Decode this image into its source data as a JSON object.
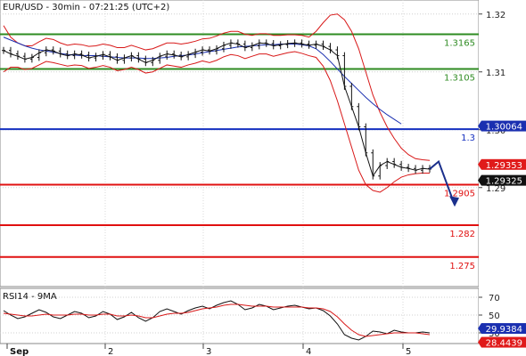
{
  "header": {
    "title": "EUR/USD - 30min - 07:21:25 (UTC+2)"
  },
  "chart_data": [
    {
      "type": "line",
      "panel": "price",
      "title": "EUR/USD - 30min - 07:21:25 (UTC+2)",
      "ylim": [
        1.2735,
        1.3215
      ],
      "y_ticks": [
        1.29,
        1.3,
        1.31,
        1.32
      ],
      "y_tick_labels": [
        "1.29",
        "1.30",
        "1.31",
        "1.32"
      ],
      "x_date_labels": [
        "Sep",
        "2",
        "3",
        "4",
        "5"
      ],
      "levels": [
        {
          "value": 1.3165,
          "label": "1.3165",
          "color": "#2e8b22"
        },
        {
          "value": 1.3105,
          "label": "1.3105",
          "color": "#2e8b22"
        },
        {
          "value": 1.3001,
          "label": "1.3",
          "color": "#1530c0"
        },
        {
          "value": 1.2905,
          "label": "1.2905",
          "color": "#e01010"
        },
        {
          "value": 1.2835,
          "label": "1.282",
          "color": "#e01010"
        },
        {
          "value": 1.278,
          "label": "1.275",
          "color": "#e01010"
        }
      ],
      "badges": [
        {
          "value": 1.30064,
          "label": "1.30064",
          "color": "#1a2fb0"
        },
        {
          "value": 1.29353,
          "label": "1.29353",
          "color": "#e01a1a"
        },
        {
          "value": 1.29325,
          "label": "1.29325",
          "color": "#111111"
        }
      ],
      "price_series": [
        1.3137,
        1.3131,
        1.3127,
        1.3122,
        1.3125,
        1.3133,
        1.3138,
        1.3136,
        1.3131,
        1.3128,
        1.3131,
        1.3129,
        1.3124,
        1.3127,
        1.313,
        1.3126,
        1.312,
        1.3124,
        1.3128,
        1.3122,
        1.3116,
        1.312,
        1.3127,
        1.3131,
        1.3129,
        1.3126,
        1.313,
        1.3134,
        1.3138,
        1.3136,
        1.314,
        1.3146,
        1.315,
        1.3148,
        1.3142,
        1.3145,
        1.315,
        1.3149,
        1.3145,
        1.3147,
        1.3149,
        1.315,
        1.3148,
        1.3146,
        1.3148,
        1.3144,
        1.3138,
        1.3128,
        1.3075,
        1.304,
        1.3005,
        1.296,
        1.292,
        1.2938,
        1.2945,
        1.294,
        1.2935,
        1.2933,
        1.293,
        1.2933,
        1.2932
      ],
      "ma_series": [
        1.316,
        1.3155,
        1.315,
        1.3145,
        1.3141,
        1.3138,
        1.3136,
        1.3134,
        1.3132,
        1.313,
        1.3129,
        1.3128,
        1.3128,
        1.3128,
        1.3127,
        1.3126,
        1.3125,
        1.3124,
        1.3124,
        1.3124,
        1.3123,
        1.3123,
        1.3124,
        1.3125,
        1.3127,
        1.3128,
        1.3129,
        1.3131,
        1.3133,
        1.3135,
        1.3137,
        1.3139,
        1.3141,
        1.3143,
        1.3144,
        1.3145,
        1.3146,
        1.3147,
        1.3147,
        1.3148,
        1.3148,
        1.3148,
        1.3147,
        1.3145,
        1.314,
        1.313,
        1.3118,
        1.3105,
        1.3092,
        1.308,
        1.3068,
        1.3056,
        1.3045,
        1.3035,
        1.3026,
        1.3018,
        1.301
      ],
      "bb_upper": [
        1.318,
        1.316,
        1.315,
        1.3145,
        1.3145,
        1.3152,
        1.3158,
        1.3156,
        1.315,
        1.3146,
        1.3148,
        1.3147,
        1.3144,
        1.3145,
        1.3148,
        1.3146,
        1.3142,
        1.3142,
        1.3146,
        1.3142,
        1.3138,
        1.314,
        1.3145,
        1.315,
        1.315,
        1.3148,
        1.315,
        1.3153,
        1.3157,
        1.3158,
        1.3162,
        1.3167,
        1.317,
        1.317,
        1.3165,
        1.3163,
        1.3166,
        1.3166,
        1.3163,
        1.3163,
        1.3164,
        1.3164,
        1.3163,
        1.316,
        1.317,
        1.3185,
        1.3198,
        1.32,
        1.319,
        1.317,
        1.314,
        1.31,
        1.306,
        1.303,
        1.3005,
        1.2985,
        1.2968,
        1.2957,
        1.295,
        1.2948,
        1.2947
      ],
      "bb_lower": [
        1.31,
        1.3108,
        1.3108,
        1.3104,
        1.3106,
        1.3112,
        1.3118,
        1.3116,
        1.3113,
        1.311,
        1.3112,
        1.3111,
        1.3106,
        1.3108,
        1.3111,
        1.3108,
        1.3102,
        1.3104,
        1.3108,
        1.3104,
        1.3098,
        1.31,
        1.3106,
        1.3112,
        1.311,
        1.3108,
        1.3112,
        1.3115,
        1.3119,
        1.3116,
        1.312,
        1.3126,
        1.313,
        1.3128,
        1.3123,
        1.3127,
        1.3131,
        1.3131,
        1.3127,
        1.313,
        1.3133,
        1.3135,
        1.3132,
        1.3128,
        1.3125,
        1.311,
        1.3085,
        1.305,
        1.301,
        1.297,
        1.293,
        1.2905,
        1.2895,
        1.2892,
        1.29,
        1.291,
        1.2918,
        1.2922,
        1.2924,
        1.2925,
        1.2925
      ],
      "projection": [
        1.2932,
        1.2945,
        1.287
      ]
    },
    {
      "type": "line",
      "panel": "indicator",
      "title": "RSI14 - 9MA",
      "ylim": [
        20,
        78
      ],
      "y_ticks": [
        30,
        50,
        70
      ],
      "y_tick_labels": [
        "30",
        "50",
        "70"
      ],
      "badges": [
        {
          "value": 29.9384,
          "label": "29.9384",
          "color": "#1a2fb0"
        },
        {
          "value": 28.4439,
          "label": "28.4439",
          "color": "#e01a1a"
        }
      ],
      "rsi_series": [
        55,
        50,
        46,
        48,
        52,
        56,
        53,
        48,
        46,
        50,
        54,
        52,
        47,
        49,
        54,
        51,
        45,
        48,
        53,
        47,
        43,
        47,
        54,
        57,
        54,
        51,
        55,
        58,
        60,
        57,
        61,
        64,
        66,
        62,
        56,
        58,
        62,
        60,
        56,
        58,
        60,
        61,
        59,
        57,
        58,
        55,
        49,
        40,
        28,
        24,
        22,
        26,
        32,
        31,
        29,
        33,
        31,
        30,
        30,
        31,
        30
      ],
      "rsi_ma_series": [
        52,
        51,
        50,
        49,
        49,
        50,
        51,
        50,
        50,
        50,
        51,
        51,
        50,
        50,
        51,
        51,
        49,
        49,
        50,
        49,
        47,
        47,
        49,
        51,
        52,
        52,
        53,
        55,
        57,
        58,
        59,
        61,
        62,
        62,
        61,
        60,
        60,
        60,
        59,
        59,
        59,
        59,
        59,
        58,
        58,
        57,
        54,
        48,
        40,
        33,
        28,
        26,
        27,
        28,
        29,
        30,
        30,
        30,
        30,
        29,
        28
      ]
    }
  ]
}
